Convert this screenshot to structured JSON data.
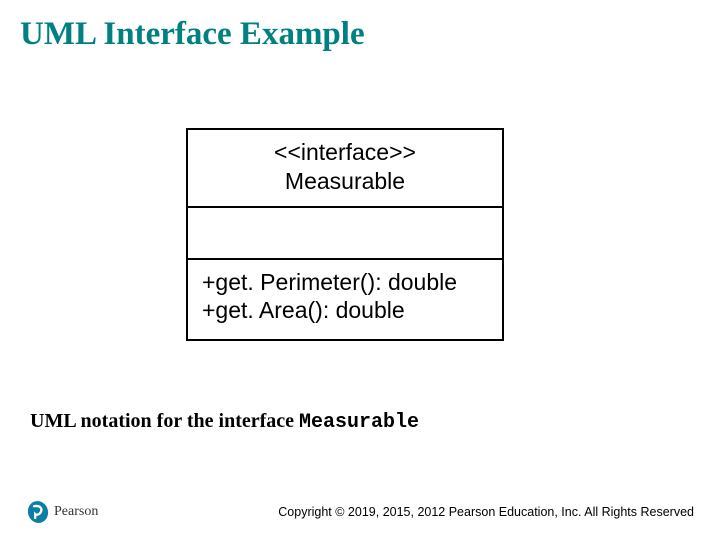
{
  "title": "UML Interface Example",
  "uml": {
    "stereotype": "<<interface>>",
    "name": "Measurable",
    "methods": [
      "+get. Perimeter(): double",
      "+get. Area(): double"
    ]
  },
  "caption": {
    "prefix": "UML notation for the interface ",
    "code": "Measurable"
  },
  "footer": {
    "brand": "Pearson",
    "copyright": "Copyright © 2019, 2015, 2012 Pearson Education, Inc. All Rights Reserved"
  }
}
